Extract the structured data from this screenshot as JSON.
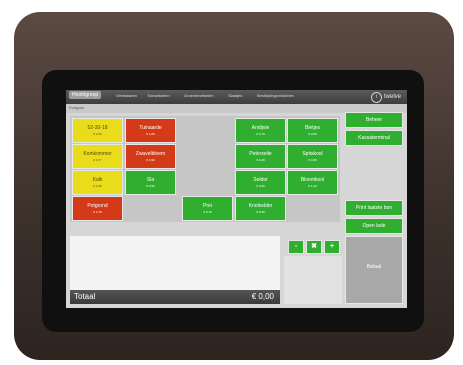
{
  "topbar": {
    "tabs": [
      {
        "label": "Hoofdgroep"
      },
      {
        "label": "Vleeswaren"
      },
      {
        "label": "Tuinartikelen"
      },
      {
        "label": "Groenteartikelen"
      },
      {
        "label": "Slaatjes"
      },
      {
        "label": "Bestrijdingsmiddelen"
      }
    ],
    "logo_text": "twelve"
  },
  "subheader": {
    "breadcrumb": "Pootgoed"
  },
  "products": [
    {
      "name": "52-30-18",
      "price": "€ 2,99",
      "color": "#e9dc1a"
    },
    {
      "name": "Tuinaarde",
      "price": "€ 1,89",
      "color": "#d43a17"
    },
    {
      "name": "Komkommer",
      "price": "€ 0,77",
      "color": "#e9dc1a"
    },
    {
      "name": "Zwavelbloem",
      "price": "€ 3,99",
      "color": "#d43a17"
    },
    {
      "name": "Kalk",
      "price": "€ 2,49",
      "color": "#e9dc1a"
    },
    {
      "name": "Sla",
      "price": "€ 0,59",
      "color": "#2fae2f"
    },
    {
      "name": "Potgrond",
      "price": "€ 2,79",
      "color": "#d43a17"
    },
    {
      "name": "Andijvie",
      "price": "€ 0,79",
      "color": "#2fae2f"
    },
    {
      "name": "Bietjes",
      "price": "€ 0,89",
      "color": "#2fae2f"
    },
    {
      "name": "Peterselie",
      "price": "€ 0,49",
      "color": "#2fae2f"
    },
    {
      "name": "Spitskool",
      "price": "€ 0,99",
      "color": "#2fae2f"
    },
    {
      "name": "Selder",
      "price": "€ 0,69",
      "color": "#2fae2f"
    },
    {
      "name": "Bloemkool",
      "price": "€ 1,29",
      "color": "#2fae2f"
    },
    {
      "name": "Prei",
      "price": "€ 0,79",
      "color": "#2fae2f"
    },
    {
      "name": "Knolselder",
      "price": "€ 0,99",
      "color": "#2fae2f"
    }
  ],
  "side_buttons": {
    "beheer": "Beheer",
    "kassaterminal": "Kassaterminal",
    "print_last": "Print laatste bon",
    "open_drawer": "Open lade",
    "pay": "Betaal"
  },
  "order_controls": {
    "minus": "-",
    "delete": "✖",
    "plus": "+"
  },
  "total": {
    "label": "Totaal",
    "value": "€ 0,00"
  }
}
